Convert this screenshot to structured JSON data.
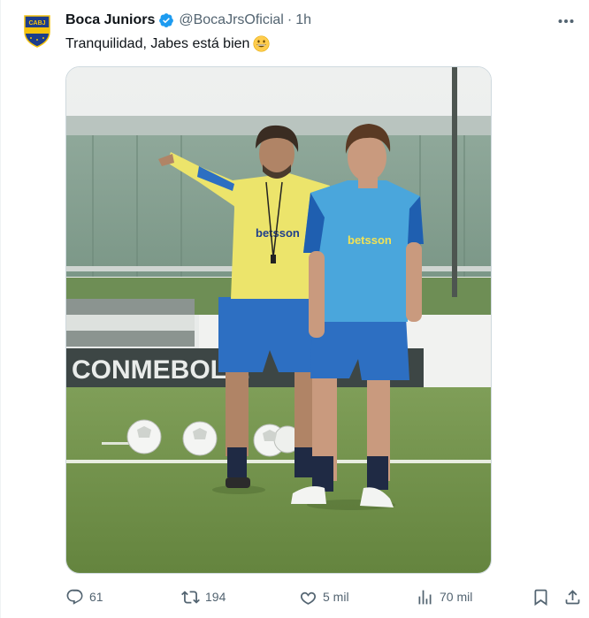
{
  "tweet": {
    "author_name": "Boca Juniors",
    "handle": "@BocaJrsOficial",
    "separator": "·",
    "time": "1h",
    "text": "Tranquilidad, Jabes está bien",
    "avatar": {
      "label": "CABJ",
      "icon": "boca-crest-icon",
      "colors": {
        "blue": "#1c3d8c",
        "gold": "#f4c20d"
      }
    },
    "verified_icon": "verified-badge-icon",
    "emoji_icon": "grinning-face-emoji",
    "media": {
      "signage_text": "CONMEBOL L",
      "shirt_sponsor": "betsson"
    }
  },
  "actions": {
    "replies": {
      "icon": "reply-icon",
      "count": "61"
    },
    "reposts": {
      "icon": "repost-icon",
      "count": "194"
    },
    "likes": {
      "icon": "like-icon",
      "count": "5 mil"
    },
    "views": {
      "icon": "views-icon",
      "count": "70 mil"
    },
    "bookmark": {
      "icon": "bookmark-icon"
    },
    "share": {
      "icon": "share-icon"
    }
  },
  "colors": {
    "text_primary": "#0f1419",
    "text_secondary": "#536471",
    "verified_blue": "#1d9bf0"
  }
}
